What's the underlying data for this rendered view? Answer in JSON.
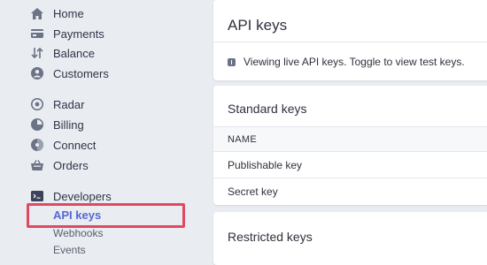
{
  "sidebar": {
    "items": [
      {
        "label": "Home",
        "icon": "home-icon"
      },
      {
        "label": "Payments",
        "icon": "payments-icon"
      },
      {
        "label": "Balance",
        "icon": "balance-icon"
      },
      {
        "label": "Customers",
        "icon": "customers-icon"
      },
      {
        "label": "Radar",
        "icon": "radar-icon"
      },
      {
        "label": "Billing",
        "icon": "billing-icon"
      },
      {
        "label": "Connect",
        "icon": "connect-icon"
      },
      {
        "label": "Orders",
        "icon": "orders-icon"
      },
      {
        "label": "Developers",
        "icon": "developers-icon"
      }
    ],
    "developer_subitems": [
      {
        "label": "API keys",
        "active": true
      },
      {
        "label": "Webhooks",
        "active": false
      },
      {
        "label": "Events",
        "active": false
      }
    ],
    "highlight_color": "#e0495f",
    "active_color": "#5469d4"
  },
  "main": {
    "header": {
      "title": "API keys"
    },
    "notice": {
      "text": "Viewing live API keys. Toggle to view test keys."
    },
    "standard_keys": {
      "title": "Standard keys",
      "column_header": "NAME",
      "rows": [
        "Publishable key",
        "Secret key"
      ]
    },
    "restricted_keys": {
      "title": "Restricted keys"
    }
  }
}
